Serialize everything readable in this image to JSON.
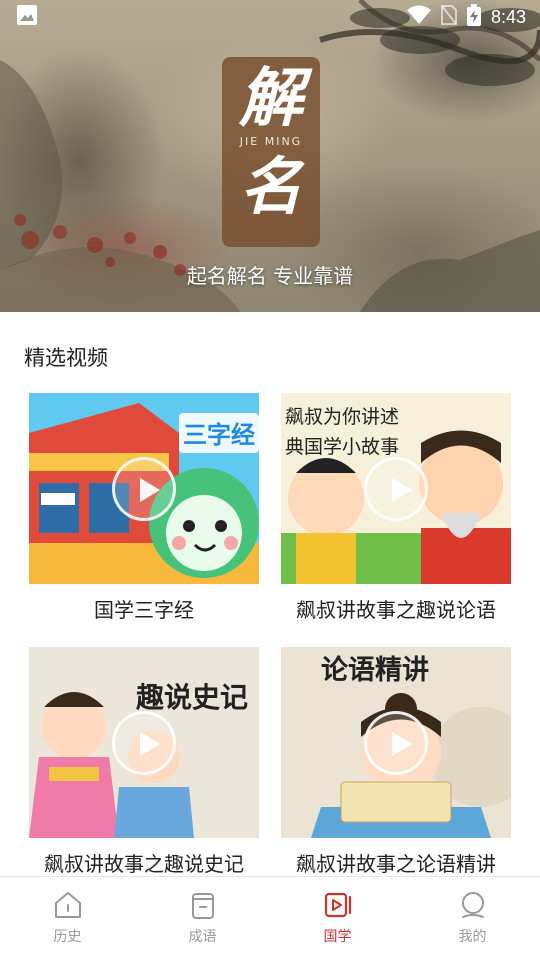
{
  "status_bar": {
    "time": "8:43"
  },
  "hero": {
    "seal_char_top": "解",
    "seal_pinyin": "JIE MING",
    "seal_char_bottom": "名",
    "slogan": "起名解名 专业靠谱"
  },
  "section": {
    "title": "精选视频"
  },
  "videos": [
    {
      "title": "国学三字经",
      "overlay_text": "三字经"
    },
    {
      "title": "飙叔讲故事之趣说论语",
      "overlay_text_1": "飙叔为你讲述",
      "overlay_text_2": "典国学小故事"
    },
    {
      "title": "飙叔讲故事之趣说史记",
      "overlay_text": "趣说史记"
    },
    {
      "title": "飙叔讲故事之论语精讲",
      "overlay_text": "论语精讲"
    }
  ],
  "nav": {
    "items": [
      {
        "label": "历史",
        "icon": "history-icon",
        "active": false
      },
      {
        "label": "成语",
        "icon": "idiom-icon",
        "active": false
      },
      {
        "label": "国学",
        "icon": "video-icon",
        "active": true
      },
      {
        "label": "我的",
        "icon": "profile-icon",
        "active": false
      }
    ],
    "active_color": "#d32f2f",
    "inactive_color": "#999999"
  }
}
